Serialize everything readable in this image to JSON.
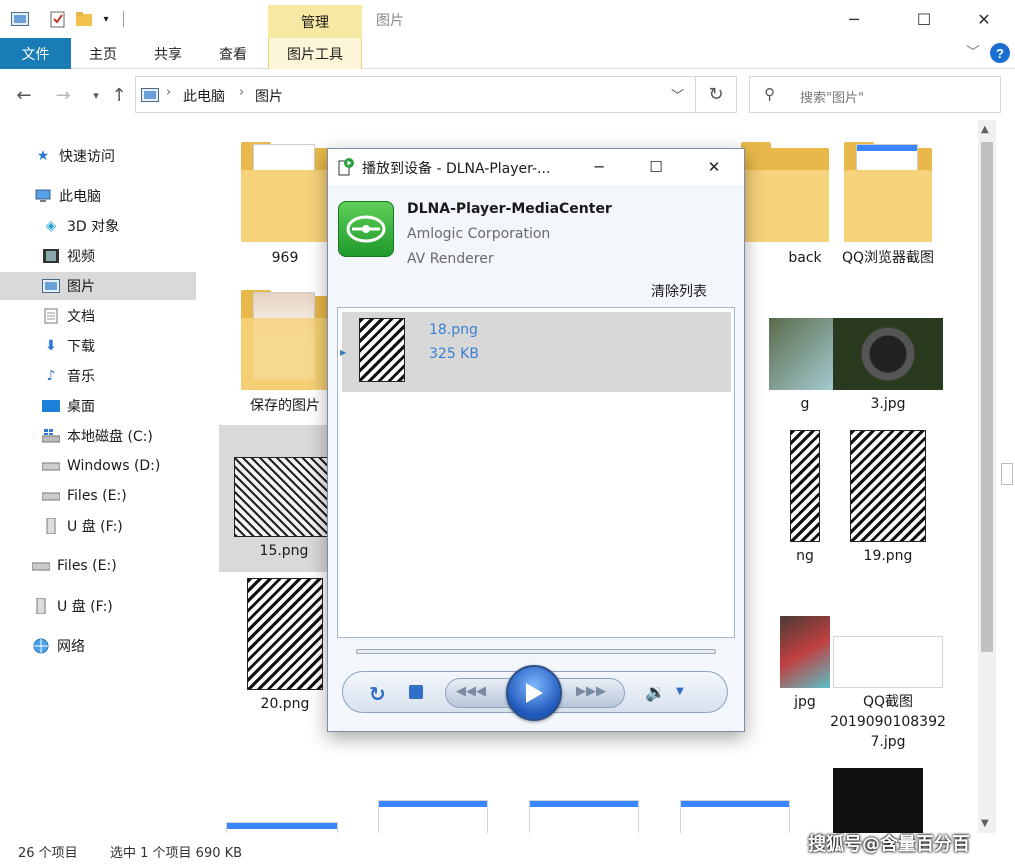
{
  "window": {
    "title": "图片",
    "manage_tab": "管理"
  },
  "ribbon": {
    "tabs": [
      "文件",
      "主页",
      "共享",
      "查看",
      "图片工具"
    ]
  },
  "address": {
    "crumbs": [
      "此电脑",
      "图片"
    ],
    "search_placeholder": "搜索\"图片\""
  },
  "nav": {
    "items": [
      {
        "label": "快速访问",
        "icon": "star-icon"
      },
      {
        "label": "此电脑",
        "icon": "computer-icon"
      },
      {
        "label": "3D 对象",
        "icon": "cube-icon"
      },
      {
        "label": "视频",
        "icon": "video-icon"
      },
      {
        "label": "图片",
        "icon": "pictures-icon",
        "selected": true
      },
      {
        "label": "文档",
        "icon": "document-icon"
      },
      {
        "label": "下载",
        "icon": "download-icon"
      },
      {
        "label": "音乐",
        "icon": "music-icon"
      },
      {
        "label": "桌面",
        "icon": "desktop-icon"
      },
      {
        "label": "本地磁盘 (C:)",
        "icon": "windows-drive-icon"
      },
      {
        "label": "Windows (D:)",
        "icon": "drive-icon"
      },
      {
        "label": "Files (E:)",
        "icon": "drive-icon"
      },
      {
        "label": "U 盘 (F:)",
        "icon": "usb-drive-icon"
      },
      {
        "label": "Files (E:)",
        "icon": "drive-icon"
      },
      {
        "label": "U 盘 (F:)",
        "icon": "usb-drive-icon"
      },
      {
        "label": "网络",
        "icon": "network-icon"
      }
    ]
  },
  "files": [
    {
      "label": "969"
    },
    {
      "label": "back"
    },
    {
      "label": "QQ浏览器截图"
    },
    {
      "label": "保存的图片"
    },
    {
      "label": "g"
    },
    {
      "label": "3.jpg"
    },
    {
      "label": "15.png"
    },
    {
      "label": "ng"
    },
    {
      "label": "19.png"
    },
    {
      "label": "20.png"
    },
    {
      "label": "jpg"
    },
    {
      "label": "QQ截图\n2019090108392\n7.jpg"
    }
  ],
  "status": {
    "count": "26 个项目",
    "selection": "选中 1 个项目  690 KB"
  },
  "watermark": "搜狐号@含量百分百",
  "dialog": {
    "title": "播放到设备 - DLNA-Player-...",
    "device_name": "DLNA-Player-MediaCenter",
    "manufacturer": "Amlogic Corporation",
    "device_type": "AV Renderer",
    "clear_list": "清除列表",
    "playlist": [
      {
        "name": "18.png",
        "size": "325 KB"
      }
    ]
  },
  "colors": {
    "file_tab": "#1a7cb5",
    "manage_tab": "#f7e9a3",
    "selection": "#d9d9d9",
    "accent_link": "#3a7fd0"
  }
}
